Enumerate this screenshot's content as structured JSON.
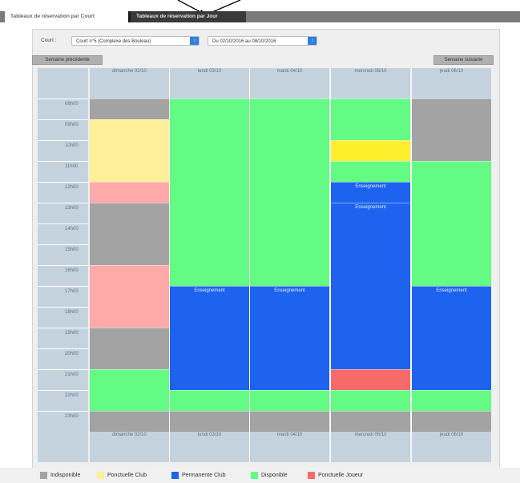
{
  "tabs": [
    {
      "label": "Tableaux de réservation par Court"
    },
    {
      "label": "Tableaux de réservation par Jour"
    }
  ],
  "filters": {
    "court_label": "Court :",
    "court_value": "Court n°5 (Complexe des Bouleau)",
    "week_value": "Du 02/10/2016 au 08/10/2016"
  },
  "nav": {
    "prev": "Semaine précédente",
    "next": "Semaine suivante"
  },
  "days": [
    "dimanche 02/10",
    "lundi 03/10",
    "mardi 04/10",
    "mercredi 05/10",
    "jeudi 06/10"
  ],
  "times": [
    "08h00",
    "09h00",
    "10h00",
    "11h00",
    "12h00",
    "13h00",
    "14h00",
    "15h00",
    "16h00",
    "17h00",
    "18h00",
    "19h00",
    "20h00",
    "21h00",
    "22h00",
    "23h00"
  ],
  "statuses": {
    "indisponible": {
      "label": "Indisponible",
      "color": "#a3a3a3"
    },
    "ponct_club": {
      "label": "Ponctuelle Club",
      "color": "#ffef99"
    },
    "perm_club": {
      "label": "Permanente Club",
      "color": "#1d63ef"
    },
    "disponible": {
      "label": "Disponible",
      "color": "#63fb83"
    },
    "ponct_joueur": {
      "label": "Ponctuelle Joueur",
      "color": "#f76a6a"
    },
    "ponct_joueur_light": {
      "label": "",
      "color": "#ffaaa8"
    },
    "ponct_club_strong": {
      "label": "",
      "color": "#fcef2c"
    }
  },
  "legend_order": [
    "indisponible",
    "ponct_club",
    "perm_club",
    "disponible",
    "ponct_joueur"
  ],
  "schedule": [
    [
      {
        "status": "indisponible",
        "start": "08h00",
        "slots": 1
      },
      {
        "status": "ponct_club",
        "start": "09h00",
        "slots": 3
      },
      {
        "status": "ponct_joueur_light",
        "start": "12h00",
        "slots": 1
      },
      {
        "status": "indisponible",
        "start": "13h00",
        "slots": 3
      },
      {
        "status": "ponct_joueur_light",
        "start": "16h00",
        "slots": 3
      },
      {
        "status": "indisponible",
        "start": "19h00",
        "slots": 2
      },
      {
        "status": "disponible",
        "start": "21h00",
        "slots": 2
      },
      {
        "status": "indisponible",
        "start": "23h00",
        "slots": 1
      }
    ],
    [
      {
        "status": "disponible",
        "start": "08h00",
        "slots": 9
      },
      {
        "status": "perm_club",
        "start": "17h00",
        "slots": 5,
        "label": "Enseignement"
      },
      {
        "status": "disponible",
        "start": "22h00",
        "slots": 1
      },
      {
        "status": "indisponible",
        "start": "23h00",
        "slots": 1
      }
    ],
    [
      {
        "status": "disponible",
        "start": "08h00",
        "slots": 9
      },
      {
        "status": "perm_club",
        "start": "17h00",
        "slots": 5,
        "label": "Enseignement"
      },
      {
        "status": "disponible",
        "start": "22h00",
        "slots": 1
      },
      {
        "status": "indisponible",
        "start": "23h00",
        "slots": 1
      }
    ],
    [
      {
        "status": "disponible",
        "start": "08h00",
        "slots": 2
      },
      {
        "status": "ponct_club_strong",
        "start": "10h00",
        "slots": 1
      },
      {
        "status": "disponible",
        "start": "11h00",
        "slots": 1
      },
      {
        "status": "perm_club",
        "start": "12h00",
        "slots": 1,
        "label": "Enseignement"
      },
      {
        "status": "perm_club",
        "start": "13h00",
        "slots": 8,
        "label": "Enseignement"
      },
      {
        "status": "ponct_joueur",
        "start": "21h00",
        "slots": 1
      },
      {
        "status": "disponible",
        "start": "22h00",
        "slots": 1
      },
      {
        "status": "indisponible",
        "start": "23h00",
        "slots": 1
      }
    ],
    [
      {
        "status": "indisponible",
        "start": "08h00",
        "slots": 3
      },
      {
        "status": "disponible",
        "start": "11h00",
        "slots": 6
      },
      {
        "status": "perm_club",
        "start": "17h00",
        "slots": 5,
        "label": "Enseignement"
      },
      {
        "status": "disponible",
        "start": "22h00",
        "slots": 1
      },
      {
        "status": "indisponible",
        "start": "23h00",
        "slots": 1
      }
    ]
  ]
}
